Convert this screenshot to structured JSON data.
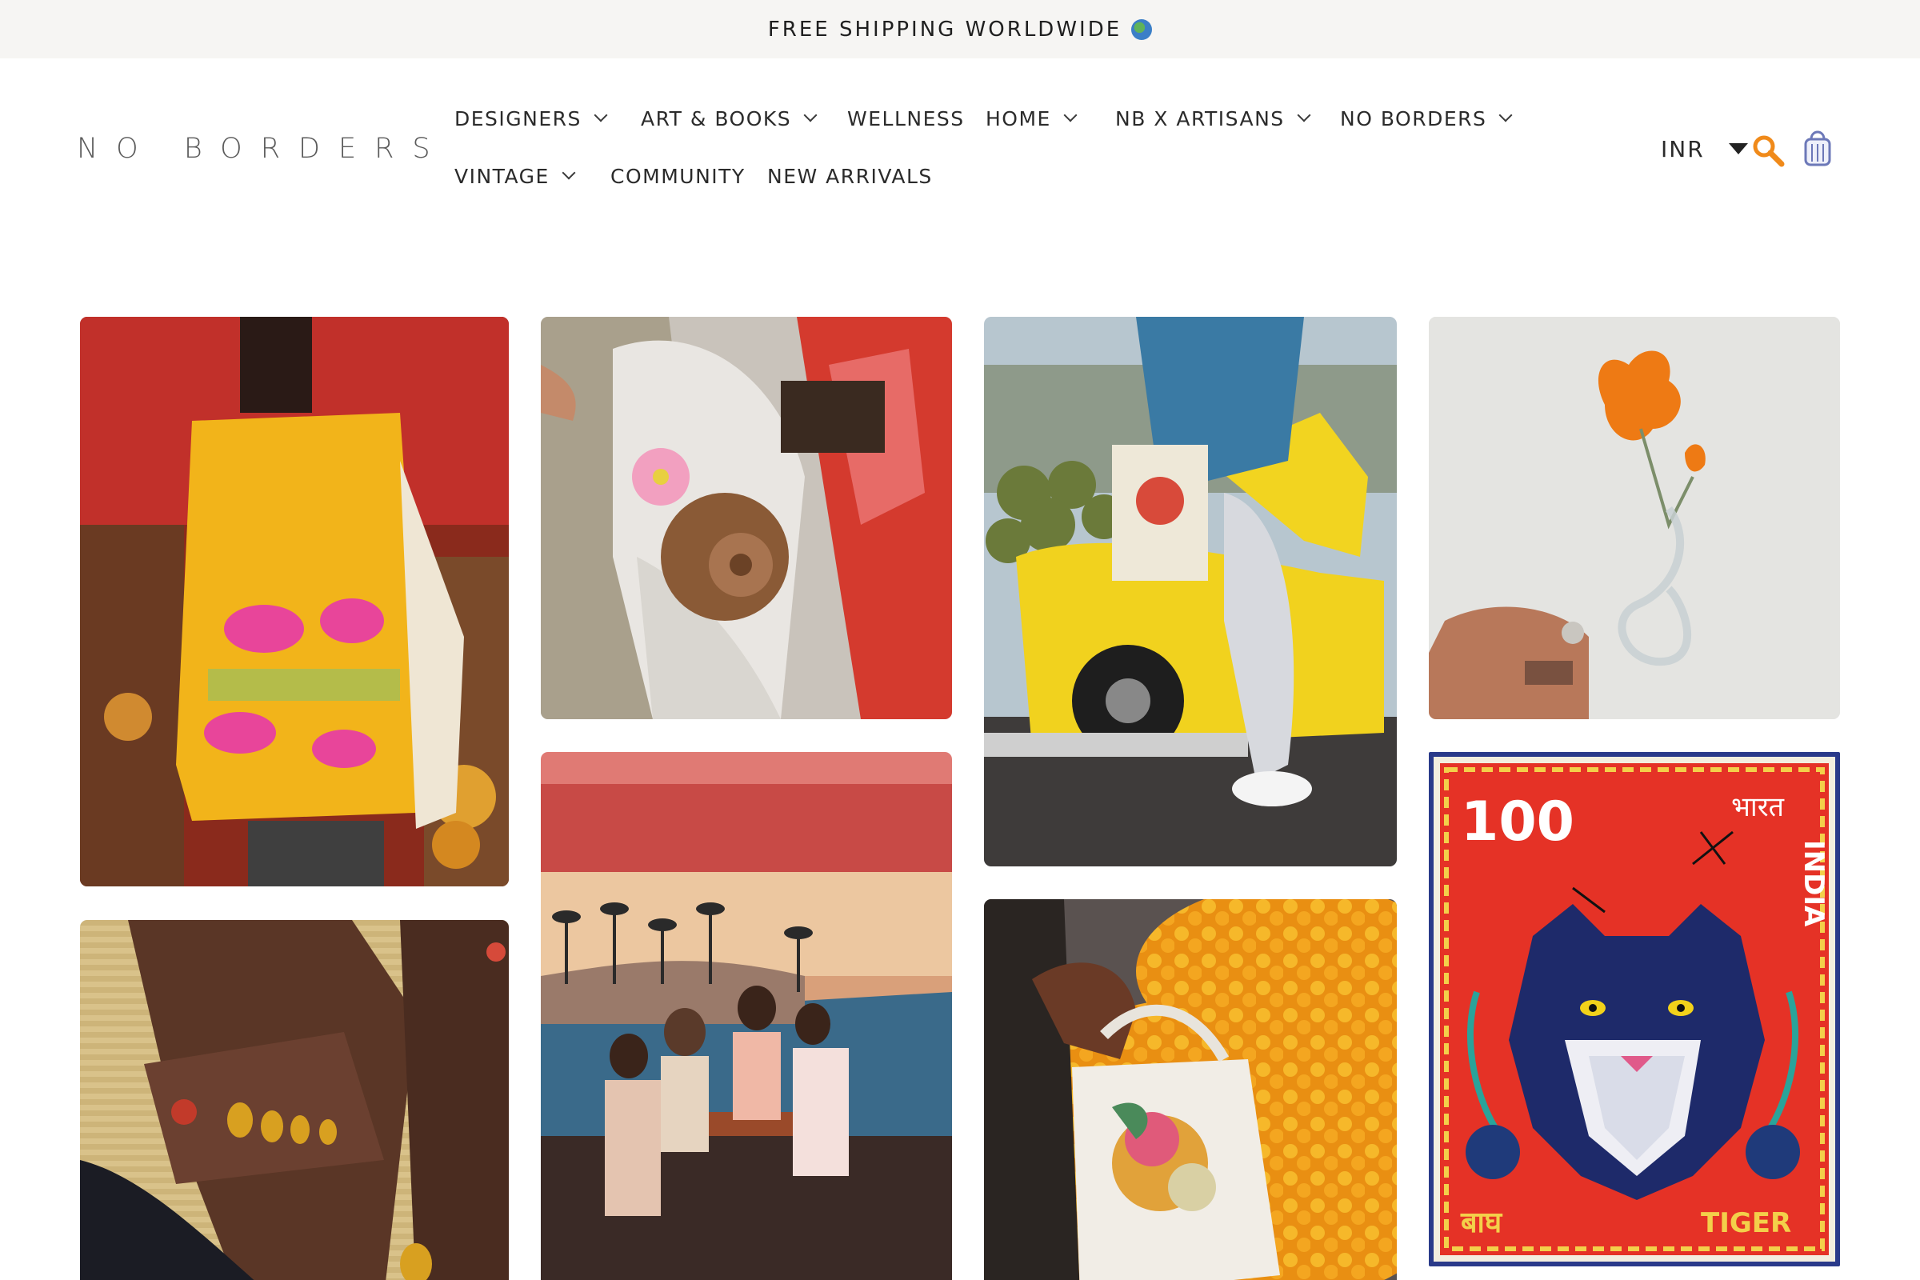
{
  "announcement": {
    "text": "FREE SHIPPING WORLDWIDE"
  },
  "logo": {
    "text": "NO BORDERS"
  },
  "nav": {
    "designers": "DESIGNERS",
    "art_books": "ART & BOOKS",
    "wellness": "WELLNESS",
    "home": "HOME",
    "nb_artisans": "NB X ARTISANS",
    "no_borders": "NO BORDERS",
    "vintage": "VINTAGE",
    "community": "COMMUNITY",
    "new_arrivals": "NEW ARRIVALS"
  },
  "header": {
    "currency": "INR"
  },
  "icons": {
    "search": "search-icon",
    "cart": "shopping-bag-icon",
    "globe": "globe-icon"
  },
  "colors": {
    "accent_orange": "#f08a1a",
    "cart_blue": "#6c78b8"
  },
  "gallery": {
    "stamp": {
      "value": "100",
      "country_hindi": "भारत",
      "country": "INDIA",
      "name_hindi": "बाघ",
      "name": "TIGER"
    }
  }
}
